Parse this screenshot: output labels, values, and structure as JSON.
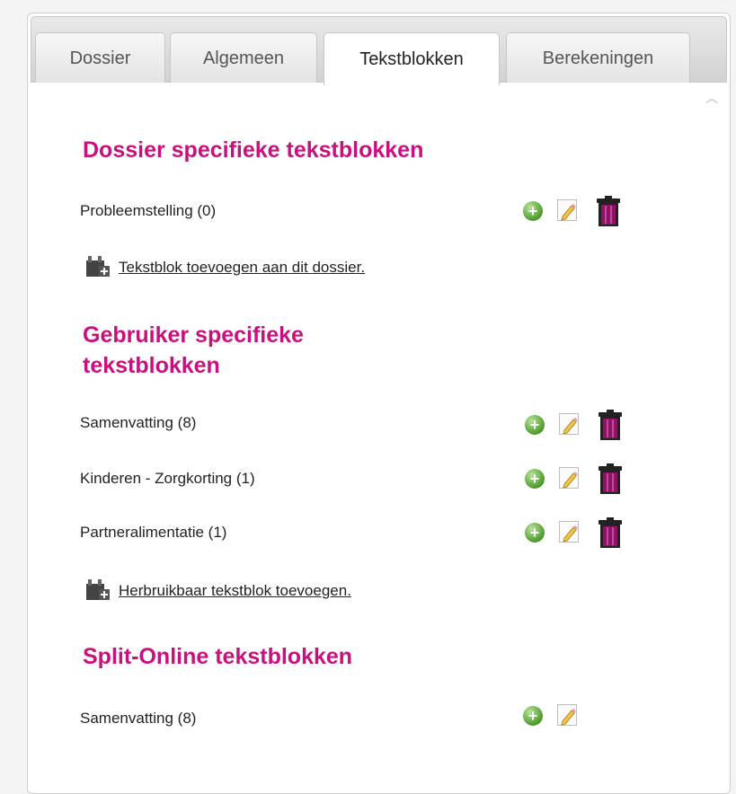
{
  "tabs": [
    {
      "label": "Dossier",
      "active": false
    },
    {
      "label": "Algemeen",
      "active": false
    },
    {
      "label": "Tekstblokken",
      "active": true
    },
    {
      "label": "Berekeningen",
      "active": false
    }
  ],
  "sections": {
    "dossier": {
      "title": "Dossier specifieke tekstblokken",
      "items": [
        {
          "label": "Probleemstelling (0)",
          "actions": [
            "add-icon",
            "edit-icon",
            "delete-icon"
          ]
        }
      ],
      "add_link": "Tekstblok toevoegen aan dit dossier."
    },
    "gebruiker": {
      "title_line1": "Gebruiker specifieke",
      "title_line2": "tekstblokken",
      "items": [
        {
          "label": "Samenvatting (8)",
          "actions": [
            "add-icon",
            "edit-icon",
            "delete-icon"
          ]
        },
        {
          "label": "Kinderen - Zorgkorting (1)",
          "actions": [
            "add-icon",
            "edit-icon",
            "delete-icon"
          ]
        },
        {
          "label": "Partneralimentatie (1)",
          "actions": [
            "add-icon",
            "edit-icon",
            "delete-icon"
          ]
        }
      ],
      "add_link": "Herbruikbaar tekstblok toevoegen."
    },
    "split_online": {
      "title": "Split-Online tekstblokken",
      "items": [
        {
          "label": "Samenvatting (8)",
          "actions": [
            "add-icon",
            "edit-icon"
          ]
        }
      ]
    }
  },
  "icons": {
    "add": "plus-circle-icon",
    "edit": "pencil-edit-icon",
    "delete": "trash-icon",
    "add_block": "add-textblock-icon",
    "scroll_up": "chevron-up-icon"
  },
  "colors": {
    "heading": "#c8117d",
    "trash": "#8e1266",
    "add_green": "#4e9a2b"
  }
}
